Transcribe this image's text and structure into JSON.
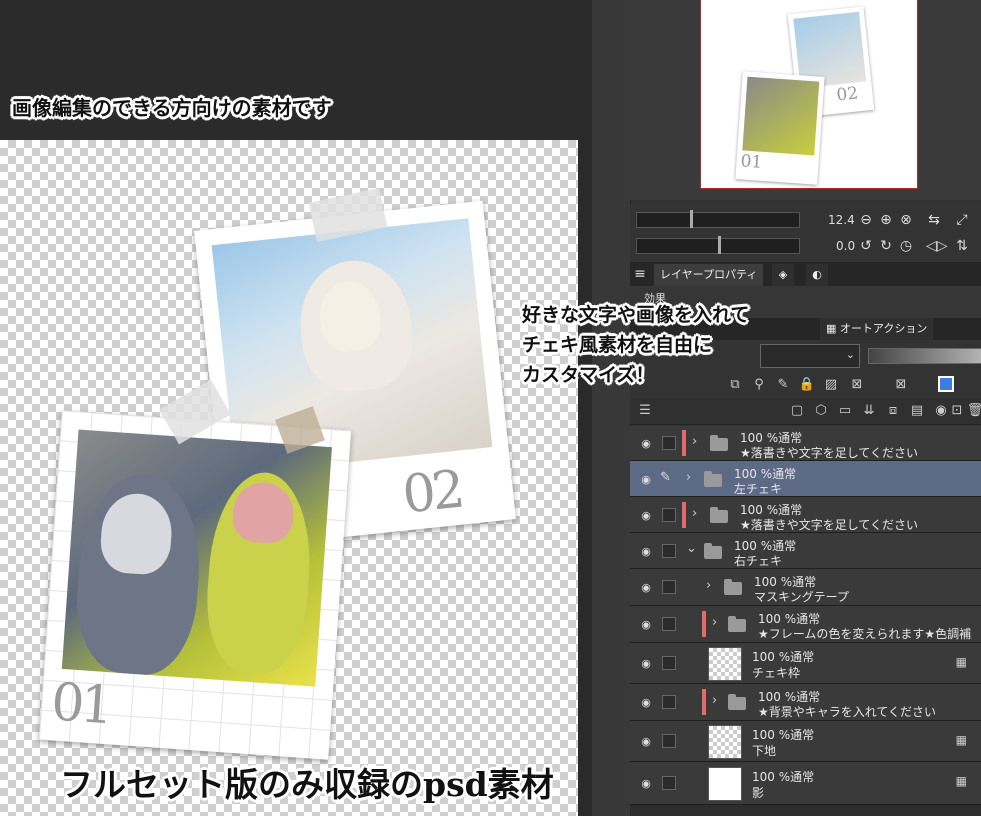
{
  "captions": {
    "top": "画像編集のできる方向けの素材です",
    "middle": [
      "好きな文字や画像を入れて",
      "チェキ風素材を自由に",
      "カスタマイズ！"
    ],
    "bottom": "フルセット版のみ収録のpsd素材"
  },
  "cards": {
    "card2_number": "02",
    "card1_number": "01"
  },
  "navigator": {
    "mini_card2_number": "02",
    "mini_card1_number": "01"
  },
  "sliders": {
    "zoom_value": "12.4",
    "rotate_value": "0.0"
  },
  "tabs": {
    "layer_property": "レイヤープロパティ",
    "auto_action": "オートアクション"
  },
  "properties": {
    "effect_label": "効果"
  },
  "blend": {
    "opacity_value": "100"
  },
  "layers": [
    {
      "mode": "100 %通常",
      "name": "★落書きや文字を足してください"
    },
    {
      "mode": "100 %通常",
      "name": "左チェキ"
    },
    {
      "mode": "100 %通常",
      "name": "★落書きや文字を足してください"
    },
    {
      "mode": "100 %通常",
      "name": "右チェキ"
    },
    {
      "mode": "100 %通常",
      "name": "マスキングテープ"
    },
    {
      "mode": "100 %通常",
      "name": "★フレームの色を変えられます★色調補正で色"
    },
    {
      "mode": "100 %通常",
      "name": "チェキ枠"
    },
    {
      "mode": "100 %通常",
      "name": "★背景やキャラを入れてください"
    },
    {
      "mode": "100 %通常",
      "name": "下地"
    },
    {
      "mode": "100 %通常",
      "name": "影"
    }
  ],
  "colors": {
    "layer_tag": "#e06b6b",
    "selected_row": "#5d6a86",
    "panel_bg": "#323232"
  }
}
